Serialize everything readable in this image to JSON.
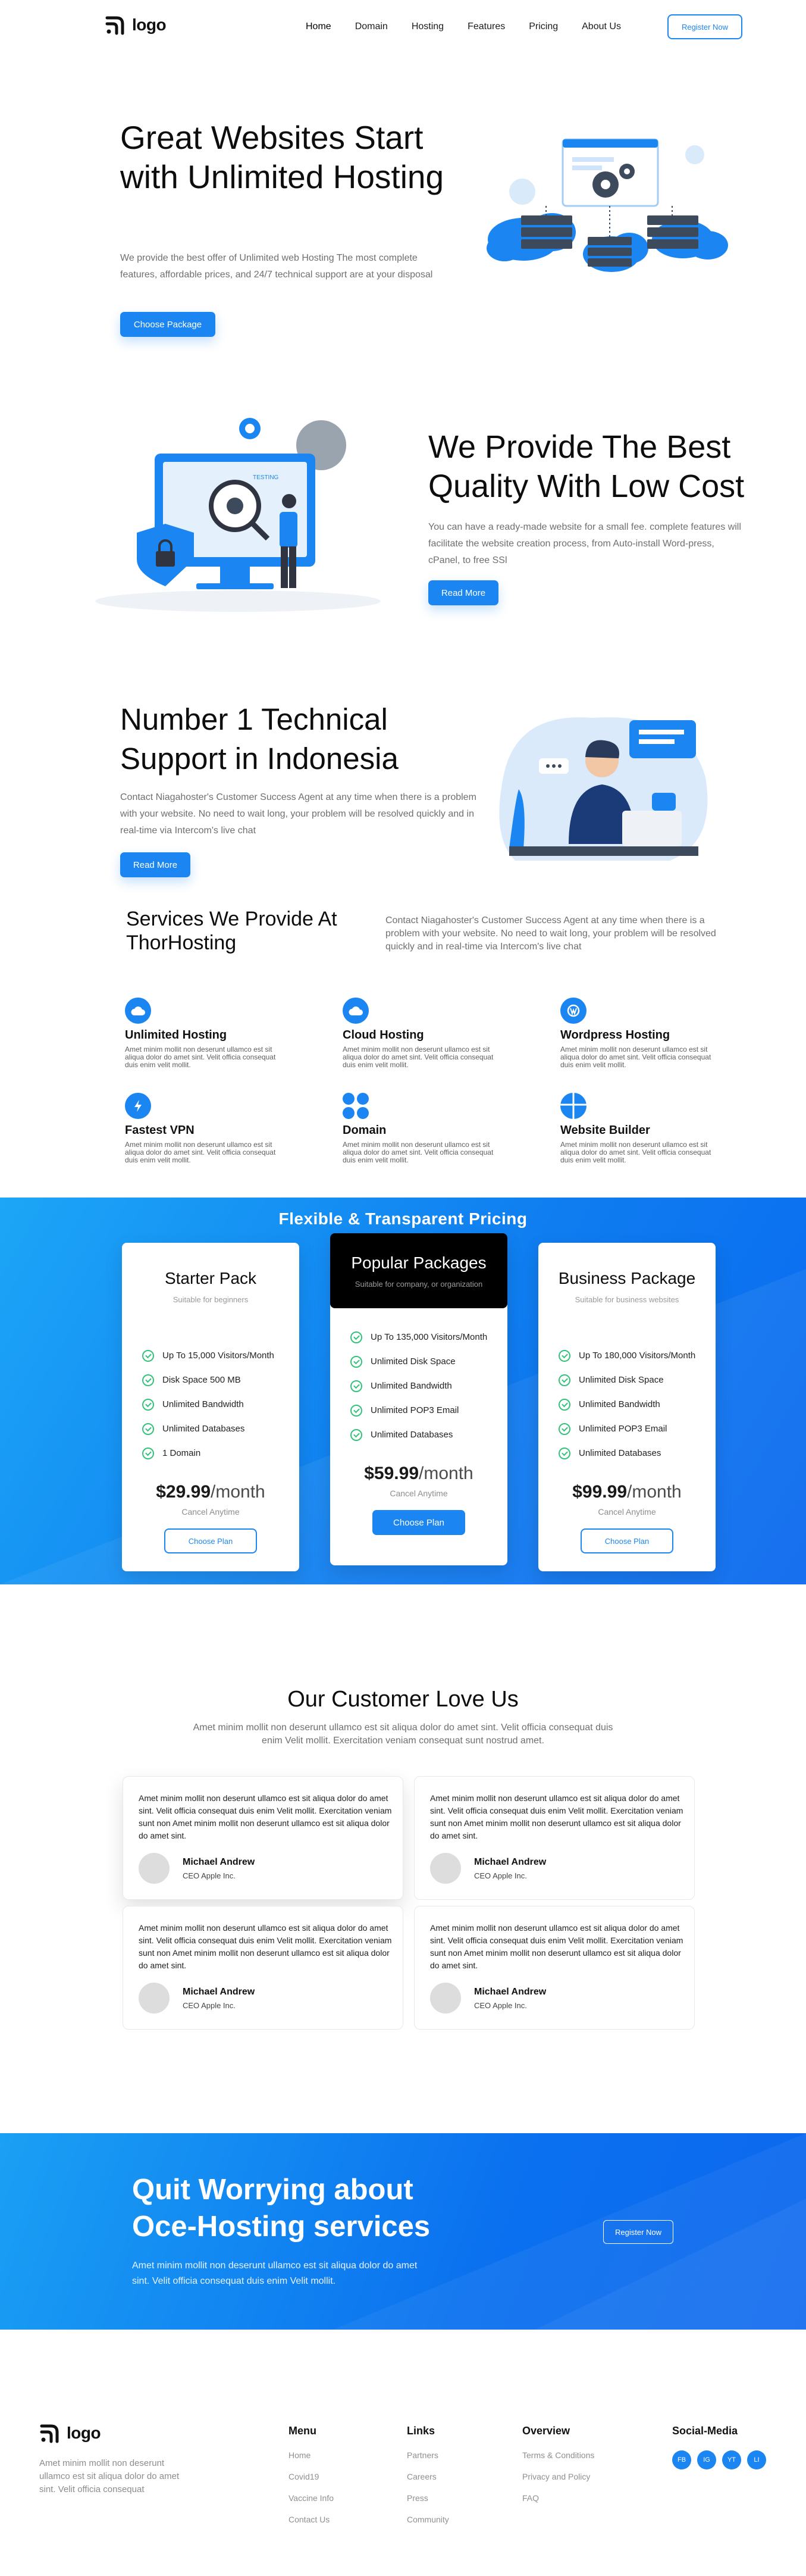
{
  "nav": {
    "logo_text": "logo",
    "links": [
      "Home",
      "Domain",
      "Hosting",
      "Features",
      "Pricing",
      "About Us"
    ],
    "cta": "Register Now"
  },
  "hero": {
    "title": "Great Websites Start with Unlimited Hosting",
    "text": "We provide the best offer of Unlimited web Hosting The most complete features, affordable prices, and 24/7 technical support are at your disposal",
    "button": "Choose Package"
  },
  "quality": {
    "title": "We Provide The Best Quality With Low Cost",
    "text": "You can have a ready-made website for a small fee. complete features will facilitate the website creation process, from Auto-install Word-press, cPanel, to free SSl",
    "button": "Read More"
  },
  "support": {
    "title": "Number 1 Technical Support in Indonesia",
    "text": "Contact Niagahoster's Customer Success Agent at any time when there is a problem with your website. No need to wait long, your problem will be resolved quickly and in real-time via Intercom's live chat",
    "button": "Read More"
  },
  "services": {
    "title": "Services We Provide At ThorHosting",
    "intro": "Contact Niagahoster's Customer Success Agent at any time when there is a problem with your website. No need to wait long, your problem will be resolved quickly and in real-time via Intercom's live chat",
    "items": [
      {
        "name": "Unlimited Hosting",
        "icon": "cloud-icon",
        "desc": "Amet minim mollit non deserunt ullamco est sit aliqua dolor do amet sint. Velit officia consequat duis enim velit mollit."
      },
      {
        "name": "Cloud Hosting",
        "icon": "cloud-icon",
        "desc": "Amet minim mollit non deserunt ullamco est sit aliqua dolor do amet sint. Velit officia consequat duis enim velit mollit."
      },
      {
        "name": "Wordpress Hosting",
        "icon": "wordpress-icon",
        "desc": "Amet minim mollit non deserunt ullamco est sit aliqua dolor do amet sint. Velit officia consequat duis enim velit mollit."
      },
      {
        "name": "Fastest VPN",
        "icon": "lightning-icon",
        "desc": "Amet minim mollit non deserunt ullamco est sit aliqua dolor do amet sint. Velit officia consequat duis enim velit mollit."
      },
      {
        "name": "Domain",
        "icon": "grid-icon",
        "desc": "Amet minim mollit non deserunt ullamco est sit aliqua dolor do amet sint. Velit officia consequat duis enim velit mollit."
      },
      {
        "name": "Website Builder",
        "icon": "layout-icon",
        "desc": "Amet minim mollit non deserunt ullamco est sit aliqua dolor do amet sint. Velit officia consequat duis enim velit mollit."
      }
    ]
  },
  "pricing": {
    "title": "Flexible & Transparent Pricing",
    "plans": [
      {
        "name": "Starter Pack",
        "sub": "Suitable for beginners",
        "features": [
          "Up To 15,000 Visitors/Month",
          "Disk Space 500 MB",
          "Unlimited Bandwidth",
          "Unlimited Databases",
          "1 Domain"
        ],
        "price": "$29.99",
        "period": "/month",
        "note": "Cancel Anytime",
        "button": "Choose Plan"
      },
      {
        "name": "Popular Packages",
        "sub": "Suitable for company, or organization",
        "features": [
          "Up To 135,000 Visitors/Month",
          "Unlimited Disk Space",
          "Unlimited Bandwidth",
          "Unlimited POP3 Email",
          "Unlimited Databases"
        ],
        "price": "$59.99",
        "period": "/month",
        "note": "Cancel Anytime",
        "button": "Choose Plan"
      },
      {
        "name": "Business Package",
        "sub": "Suitable for business websites",
        "features": [
          "Up To 180,000 Visitors/Month",
          "Unlimited Disk Space",
          "Unlimited Bandwidth",
          "Unlimited POP3 Email",
          "Unlimited Databases"
        ],
        "price": "$99.99",
        "period": "/month",
        "note": "Cancel Anytime",
        "button": "Choose Plan"
      }
    ]
  },
  "testimonials": {
    "title": "Our Customer Love Us",
    "sub": "Amet minim mollit non deserunt ullamco est sit aliqua dolor do amet sint. Velit officia consequat duis enim Velit mollit. Exercitation veniam consequat sunt nostrud amet.",
    "items": [
      {
        "quote": "Amet minim mollit non deserunt ullamco est sit aliqua dolor do amet sint. Velit officia consequat duis enim Velit mollit. Exercitation veniam sunt non Amet minim mollit non deserunt ullamco est sit aliqua dolor do amet sint.",
        "name": "Michael Andrew",
        "role": "CEO Apple Inc."
      },
      {
        "quote": "Amet minim mollit non deserunt ullamco est sit aliqua dolor do amet sint. Velit officia consequat duis enim Velit mollit. Exercitation veniam sunt non Amet minim mollit non deserunt ullamco est sit aliqua dolor do amet sint.",
        "name": "Michael Andrew",
        "role": "CEO Apple Inc."
      },
      {
        "quote": "Amet minim mollit non deserunt ullamco est sit aliqua dolor do amet sint. Velit officia consequat duis enim Velit mollit. Exercitation veniam sunt non Amet minim mollit non deserunt ullamco est sit aliqua dolor do amet sint.",
        "name": "Michael Andrew",
        "role": "CEO Apple Inc."
      },
      {
        "quote": "Amet minim mollit non deserunt ullamco est sit aliqua dolor do amet sint. Velit officia consequat duis enim Velit mollit. Exercitation veniam sunt non Amet minim mollit non deserunt ullamco est sit aliqua dolor do amet sint.",
        "name": "Michael Andrew",
        "role": "CEO Apple Inc."
      }
    ]
  },
  "cta": {
    "title": "Quit Worrying about Oce-Hosting services",
    "text": "Amet minim mollit non deserunt ullamco est sit aliqua dolor do amet sint. Velit officia consequat duis enim Velit mollit.",
    "button": "Register Now"
  },
  "footer": {
    "logo_text": "logo",
    "about": "Amet minim mollit non deserunt ullamco est sit aliqua dolor do amet sint. Velit officia consequat",
    "menu": {
      "title": "Menu",
      "links": [
        "Home",
        "Covid19",
        "Vaccine Info",
        "Contact Us"
      ]
    },
    "links": {
      "title": "Links",
      "links": [
        "Partners",
        "Careers",
        "Press",
        "Community"
      ]
    },
    "overview": {
      "title": "Overview",
      "links": [
        "Terms & Conditions",
        "Privacy and Policy",
        "FAQ"
      ]
    },
    "social": {
      "title": "Social-Media",
      "items": [
        "FB",
        "IG",
        "YT",
        "LI"
      ]
    }
  },
  "colors": {
    "accent": "#1b86f2",
    "dark": "#0d0d0d",
    "muted": "#6f6f6f",
    "check": "#33c27a"
  }
}
